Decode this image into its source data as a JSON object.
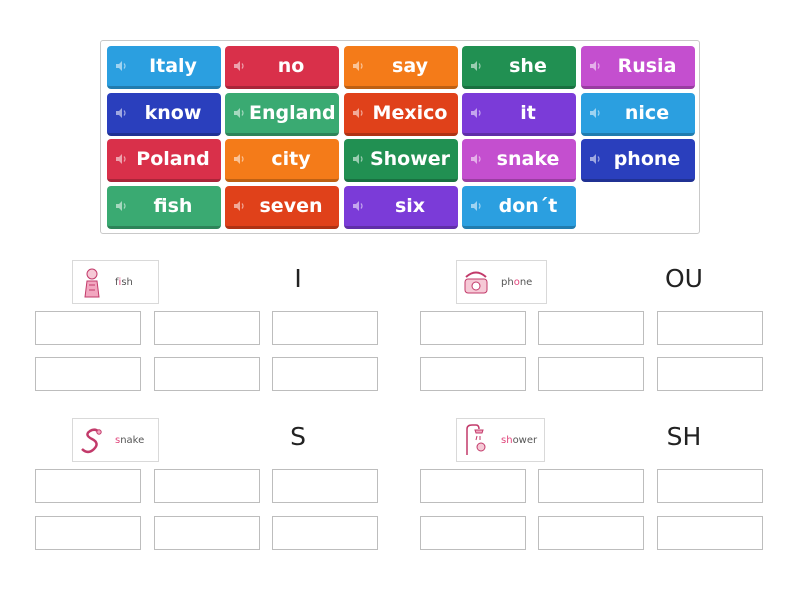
{
  "tiles": [
    {
      "label": "Italy",
      "color": "#2b9fe0"
    },
    {
      "label": "no",
      "color": "#d9304a"
    },
    {
      "label": "say",
      "color": "#f47b19"
    },
    {
      "label": "she",
      "color": "#219052"
    },
    {
      "label": "Rusia",
      "color": "#c44fcf"
    },
    {
      "label": "know",
      "color": "#2a3fbd"
    },
    {
      "label": "England",
      "color": "#3aaa72"
    },
    {
      "label": "Mexico",
      "color": "#e0411a"
    },
    {
      "label": "it",
      "color": "#7b3bd8"
    },
    {
      "label": "nice",
      "color": "#2b9fe0"
    },
    {
      "label": "Poland",
      "color": "#d9304a"
    },
    {
      "label": "city",
      "color": "#f47b19"
    },
    {
      "label": "Shower",
      "color": "#219052"
    },
    {
      "label": "snake",
      "color": "#c44fcf"
    },
    {
      "label": "phone",
      "color": "#2a3fbd"
    },
    {
      "label": "fish",
      "color": "#3aaa72"
    },
    {
      "label": "seven",
      "color": "#e0411a"
    },
    {
      "label": "six",
      "color": "#7b3bd8"
    },
    {
      "label": "don´t",
      "color": "#2b9fe0"
    }
  ],
  "groups": [
    {
      "heading": "I",
      "card": {
        "pre": "f",
        "hl": "i",
        "post": "sh",
        "icon": "fish-card-icon"
      }
    },
    {
      "heading": "OU",
      "card": {
        "pre": "ph",
        "hl": "o",
        "post": "ne",
        "icon": "phone-card-icon"
      }
    },
    {
      "heading": "S",
      "card": {
        "pre": "",
        "hl": "s",
        "post": "nake",
        "icon": "snake-card-icon"
      }
    },
    {
      "heading": "SH",
      "card": {
        "pre": "",
        "hl": "sh",
        "post": "ower",
        "icon": "shower-card-icon"
      }
    }
  ],
  "colors": {
    "highlight": "#e0457b",
    "slot_border": "#bdbdbd",
    "tile_panel_border": "#c9c9c9"
  }
}
